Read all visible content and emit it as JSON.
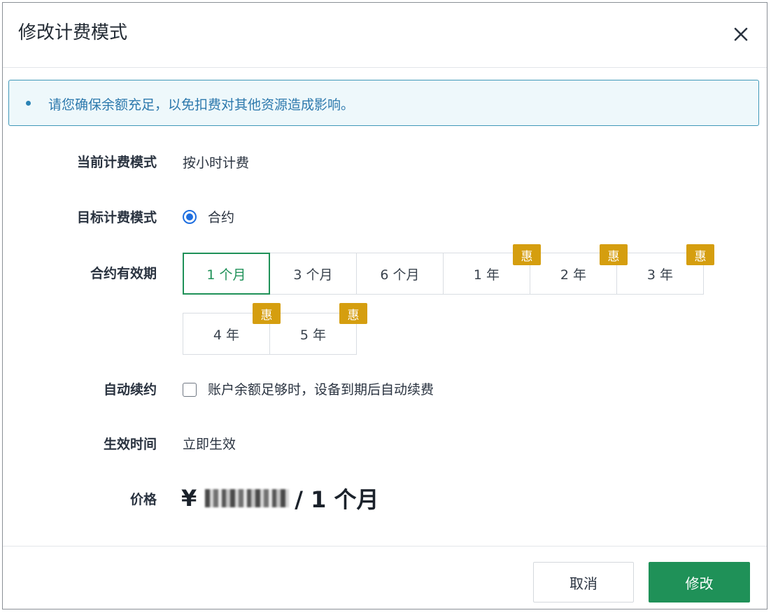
{
  "dialog": {
    "title": "修改计费模式",
    "close_icon": "close-icon"
  },
  "alert": {
    "text": "请您确保余额充足，以免扣费对其他资源造成影响。",
    "color": "#2d79ad"
  },
  "form": {
    "current_mode": {
      "label": "当前计费模式",
      "value": "按小时计费"
    },
    "target_mode": {
      "label": "目标计费模式",
      "option": "合约",
      "selected": true
    },
    "period": {
      "label": "合约有效期",
      "options": [
        {
          "label": "1 个月",
          "selected": true,
          "badge": ""
        },
        {
          "label": "3 个月",
          "selected": false,
          "badge": ""
        },
        {
          "label": "6 个月",
          "selected": false,
          "badge": ""
        },
        {
          "label": "1 年",
          "selected": false,
          "badge": "惠"
        },
        {
          "label": "2 年",
          "selected": false,
          "badge": "惠"
        },
        {
          "label": "3 年",
          "selected": false,
          "badge": "惠"
        },
        {
          "label": "4 年",
          "selected": false,
          "badge": "惠"
        },
        {
          "label": "5 年",
          "selected": false,
          "badge": "惠"
        }
      ]
    },
    "auto_renew": {
      "label": "自动续约",
      "checkbox_label": "账户余额足够时，设备到期后自动续费",
      "checked": false
    },
    "effective_time": {
      "label": "生效时间",
      "value": "立即生效"
    },
    "price": {
      "label": "价格",
      "currency": "¥",
      "per": "/ 1 个月"
    }
  },
  "footer": {
    "cancel_label": "取消",
    "confirm_label": "修改"
  },
  "colors": {
    "accent": "#1f9158",
    "radio": "#1f6fe0",
    "badge": "#d59e0f",
    "alert_border": "#3f97b8"
  }
}
